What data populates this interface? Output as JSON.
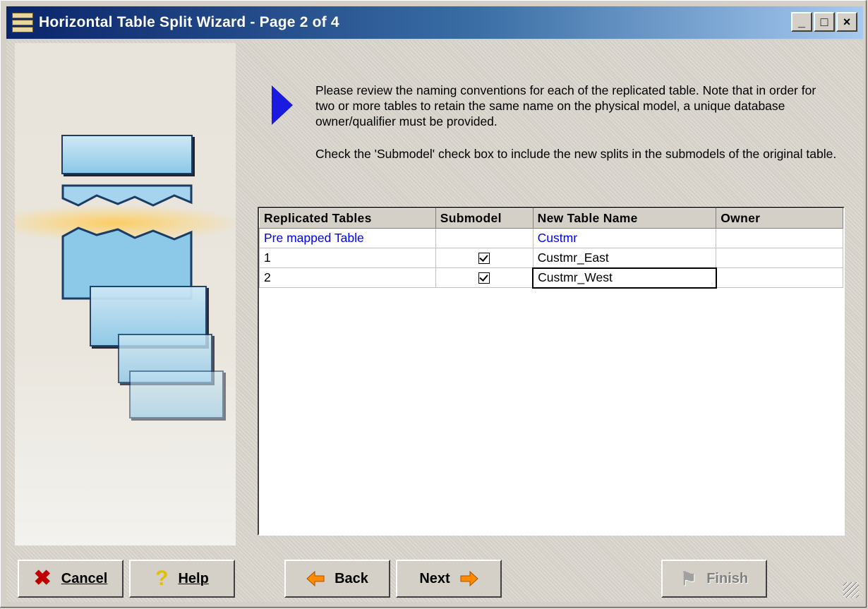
{
  "window": {
    "title": "Horizontal Table Split Wizard - Page 2 of 4",
    "controls": {
      "minimize": "_",
      "maximize": "□",
      "close": "×"
    }
  },
  "instructions": {
    "paragraph1": "Please review the naming conventions for each of the replicated table. Note that in order for two or more tables to retain the same name on the physical model, a unique database owner/qualifier must be provided.",
    "paragraph2": "Check the 'Submodel' check box to include the new splits in the submodels of the original table."
  },
  "grid": {
    "columns": [
      "Replicated Tables",
      "Submodel",
      "New Table Name",
      "Owner"
    ],
    "rows": [
      {
        "replicated": "Pre mapped Table",
        "submodel": false,
        "new_name": "Custmr",
        "owner": ""
      },
      {
        "replicated": "1",
        "submodel": true,
        "new_name": "Custmr_East",
        "owner": ""
      },
      {
        "replicated": "2",
        "submodel": true,
        "new_name": "Custmr_West",
        "owner": ""
      }
    ]
  },
  "buttons": {
    "cancel": "Cancel",
    "help": "Help",
    "back": "Back",
    "next": "Next",
    "finish": "Finish"
  },
  "icons": {
    "cancel": "x-icon",
    "help": "question-icon",
    "back": "left-arrow-icon",
    "next": "right-arrow-icon",
    "finish": "flag-icon"
  },
  "colors": {
    "title_gradient_start": "#0a246a",
    "link_blue": "#0000ff",
    "wizard_arrow": "#1a1ae0"
  }
}
